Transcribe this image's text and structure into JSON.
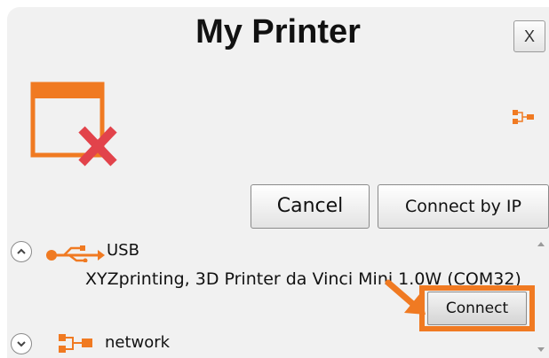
{
  "dialog": {
    "title": "My Printer",
    "close_label": "X",
    "status_icon": "printer-disconnected-icon"
  },
  "buttons": {
    "cancel_label": "Cancel",
    "connect_by_ip_label": "Connect by IP",
    "connect_label": "Connect"
  },
  "list": {
    "usb": {
      "label": "USB",
      "expanded": true,
      "devices": [
        {
          "name": "XYZprinting, 3D Printer da Vinci Mini 1.0W (COM32)"
        }
      ]
    },
    "network": {
      "label": "network",
      "expanded": false
    }
  },
  "colors": {
    "accent": "#f07a22",
    "error_x": "#e2434b",
    "background": "#f1f1f1"
  }
}
